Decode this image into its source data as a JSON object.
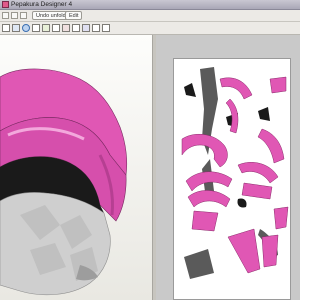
{
  "window": {
    "title": "Pepakura Designer 4"
  },
  "toolbar": {
    "undo_unfold_label": "Undo unfold",
    "edit_label": "Edit"
  },
  "colors": {
    "helmet_pink": "#e057b4",
    "helmet_silver": "#cfcfcf",
    "visor_black": "#1a1a1a",
    "paper_bg": "#ffffff",
    "workspace_bg": "#c9c9c9"
  },
  "icons": [
    "open-icon",
    "save-icon",
    "print-icon",
    "copy-icon",
    "paste-icon",
    "zoom-icon",
    "rotate-icon",
    "select-icon",
    "flap-icon",
    "unfold-icon",
    "texture-icon",
    "settings-icon"
  ]
}
